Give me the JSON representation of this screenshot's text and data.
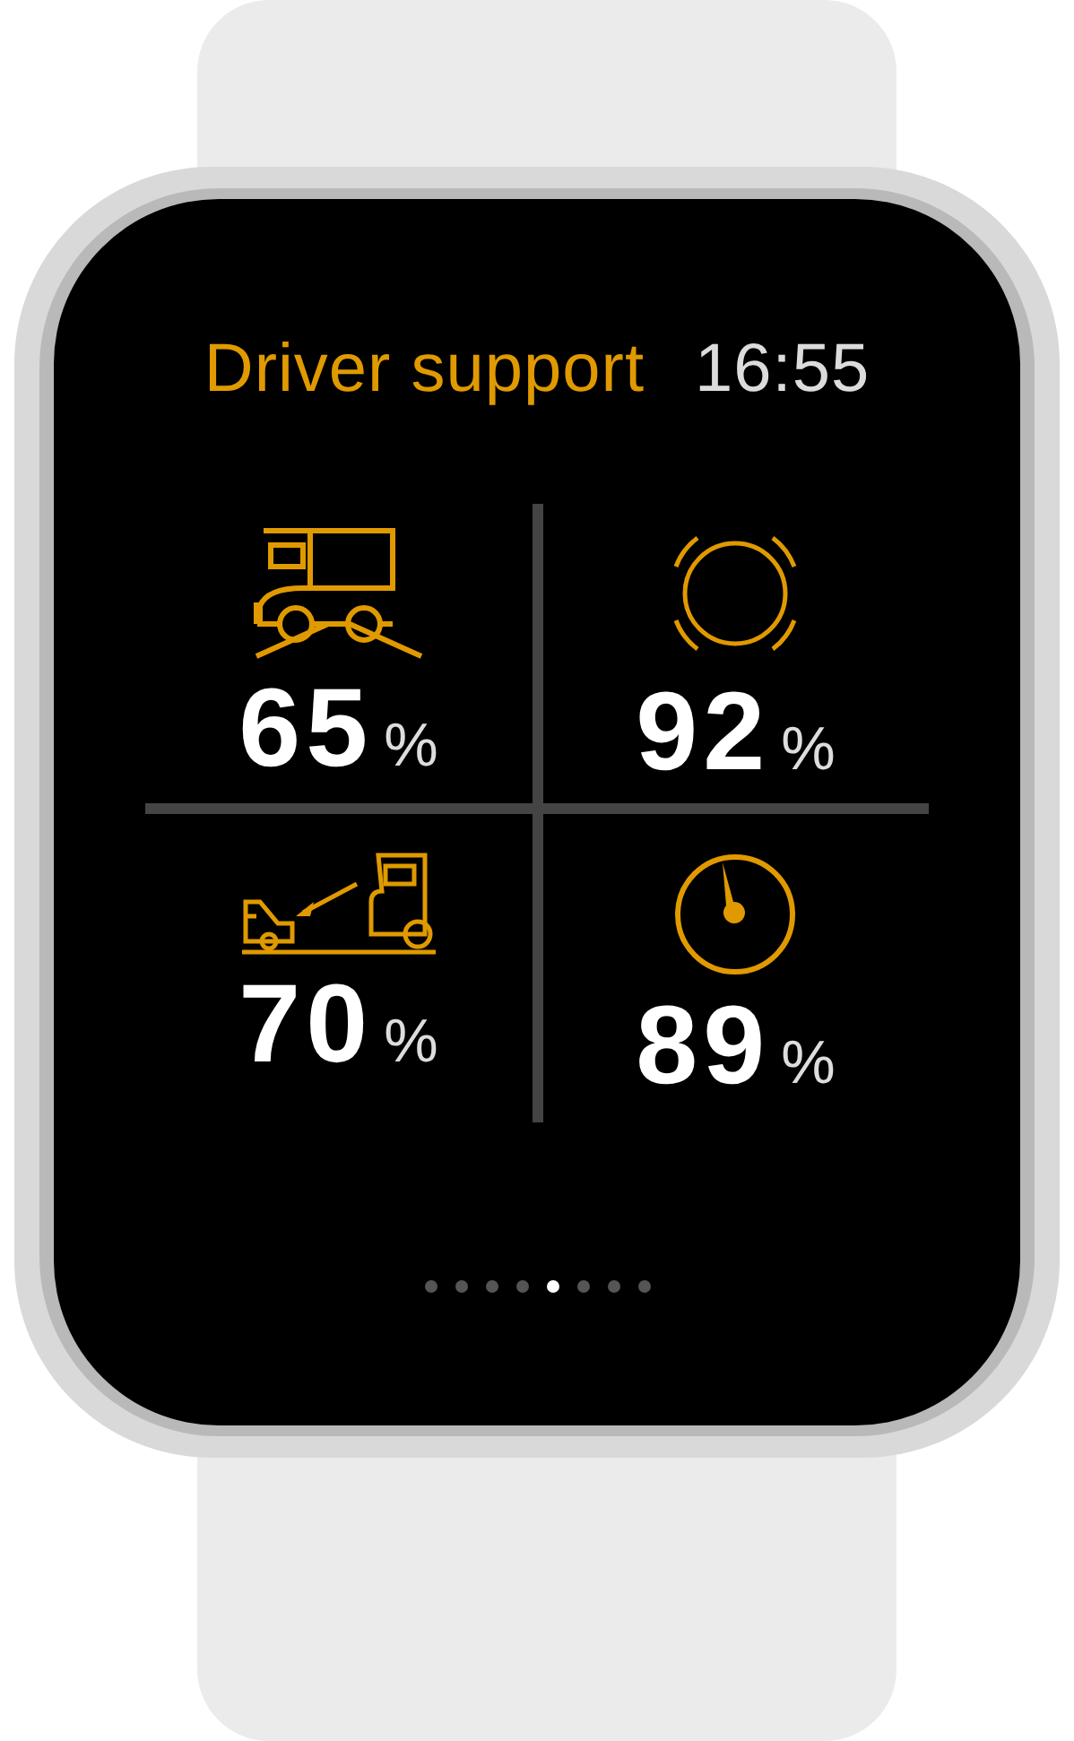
{
  "header": {
    "title": "Driver support",
    "time": "16:55"
  },
  "tiles": [
    {
      "kind": "truck-ramp",
      "value": "65",
      "unit": "%"
    },
    {
      "kind": "brake",
      "value": "92",
      "unit": "%"
    },
    {
      "kind": "following",
      "value": "70",
      "unit": "%"
    },
    {
      "kind": "speed",
      "value": "89",
      "unit": "%"
    }
  ],
  "page_dots": [
    {
      "selected": false
    },
    {
      "selected": false
    },
    {
      "selected": false
    },
    {
      "selected": false
    },
    {
      "selected": true
    },
    {
      "selected": false
    },
    {
      "selected": false
    },
    {
      "selected": false
    }
  ]
}
